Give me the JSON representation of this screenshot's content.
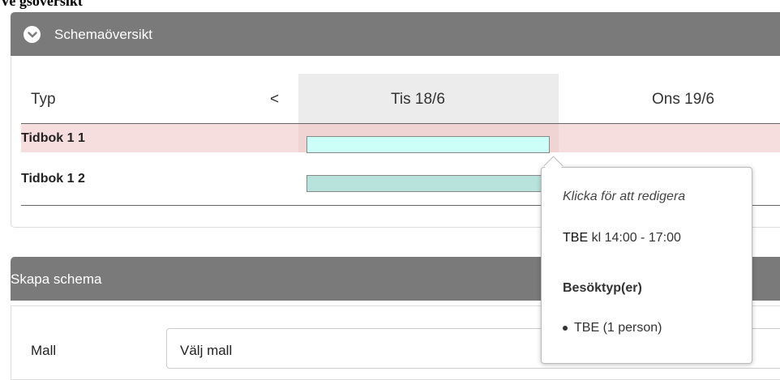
{
  "top_cut_text": "Ve  gsöversikt",
  "overview": {
    "title": "Schemaöversikt",
    "header": {
      "type_col": "Typ",
      "prev": "<",
      "day1": "Tis 18/6",
      "day2": "Ons 19/6"
    },
    "rows": [
      {
        "label": "Tidbok 1 1"
      },
      {
        "label": "Tidbok 1 2"
      }
    ]
  },
  "tooltip": {
    "hint": "Klicka för att redigera",
    "code": "TBE",
    "time": " kl 14:00 - 17:00",
    "types_heading": "Besöktyp(er)",
    "types": [
      "TBE (1 person)"
    ]
  },
  "create": {
    "title": "Skapa schema",
    "template_label": "Mall",
    "template_value": "Välj mall"
  },
  "colors": {
    "header_bg": "#7a7a7a",
    "selected_row": "#f7dede",
    "slot_active": "#ccfff8",
    "slot": "#b8e3dc"
  }
}
